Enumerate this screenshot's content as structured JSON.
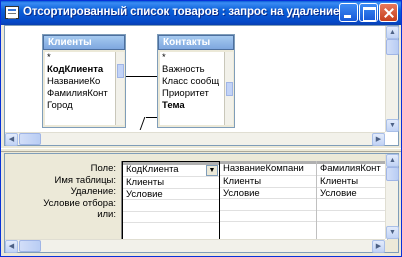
{
  "window": {
    "title": "Отсортированный список товаров : запрос на удаление"
  },
  "tables": [
    {
      "name": "Клиенты",
      "fields": [
        "*",
        "КодКлиента",
        "НазваниеКо",
        "ФамилияКонт",
        "Город"
      ],
      "bold_field_index": 1
    },
    {
      "name": "Контакты",
      "fields": [
        "*",
        "Важность",
        "Класс сообщ",
        "Приоритет",
        "Тема"
      ],
      "bold_field_index": 4
    }
  ],
  "grid": {
    "row_labels": [
      "Поле:",
      "Имя таблицы:",
      "Удаление:",
      "Условие отбора:",
      "или:"
    ],
    "columns": [
      {
        "field": "КодКлиента",
        "table": "Клиенты",
        "delete": "Условие"
      },
      {
        "field": "НазваниеКомпани",
        "table": "Клиенты",
        "delete": "Условие"
      },
      {
        "field": "ФамилияКонт",
        "table": "Клиенты",
        "delete": "Условие"
      }
    ]
  },
  "icons": {
    "app": "query-icon",
    "minimize": "minimize-icon",
    "maximize": "maximize-icon",
    "close": "close-icon",
    "dropdown": "chevron-down-icon"
  }
}
